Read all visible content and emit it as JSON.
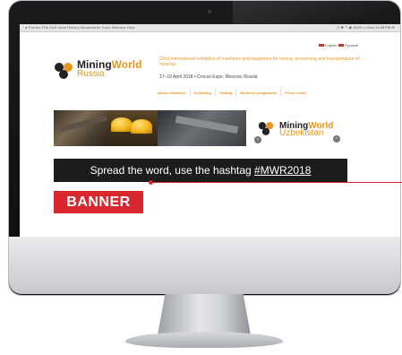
{
  "screen": {
    "os_menu": "●  Firefox   File   Edit   View   History   Bookmarks   Tools   Window   Help",
    "os_status": "◷ ✱ ⇡ ◉ 100% ▭  Mon 12:45 PM  ☰"
  },
  "site": {
    "lang_en": "English",
    "lang_ru": "Русский",
    "brand_part1": "Mining",
    "brand_part2": "World",
    "brand_sub": "Russia",
    "headline": "22nd International exhibition of machines and equipment for mining, processing and transportation of minerals",
    "dateline": "17–19 April 2018 • Crocus Expo, Moscow, Russia",
    "nav": [
      {
        "label": "About exhibition"
      },
      {
        "label": "Exhibiting"
      },
      {
        "label": "Visiting"
      },
      {
        "label": "Business programme"
      },
      {
        "label": "Press centre"
      }
    ]
  },
  "slider": {
    "brand_part1": "Mining",
    "brand_part2": "World",
    "brand_sub": "Uzbekistan",
    "prev_icon": "‹",
    "next_icon": "›"
  },
  "hashtag_bar": {
    "text": "Spread the word, use the hashtag ",
    "tag": "#MWR2018"
  },
  "banner_label": "BANNER",
  "colors": {
    "accent_orange": "#e8961e",
    "banner_red": "#d8272f",
    "bar_dark": "#1c1c1c"
  }
}
